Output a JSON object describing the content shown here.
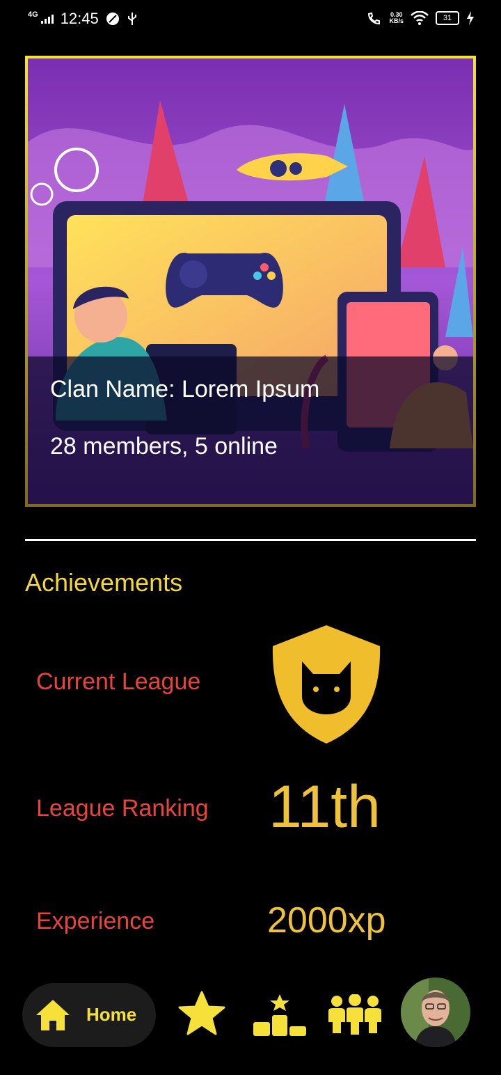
{
  "status_bar": {
    "network": "4G",
    "time": "12:45",
    "speed": "0.30",
    "speed_unit": "KB/s",
    "battery": "31"
  },
  "clan": {
    "name_line": "Clan Name: Lorem Ipsum",
    "members_line": "28 members, 5 online"
  },
  "achievements": {
    "title": "Achievements",
    "current_league_label": "Current League",
    "league_ranking_label": "League Ranking",
    "league_ranking_value": "11th",
    "experience_label": "Experience",
    "experience_value": "2000xp"
  },
  "nav": {
    "home_label": "Home"
  },
  "colors": {
    "accent_yellow": "#f5e13a",
    "label_red": "#e8443a",
    "value_gold": "#f0c23a"
  }
}
